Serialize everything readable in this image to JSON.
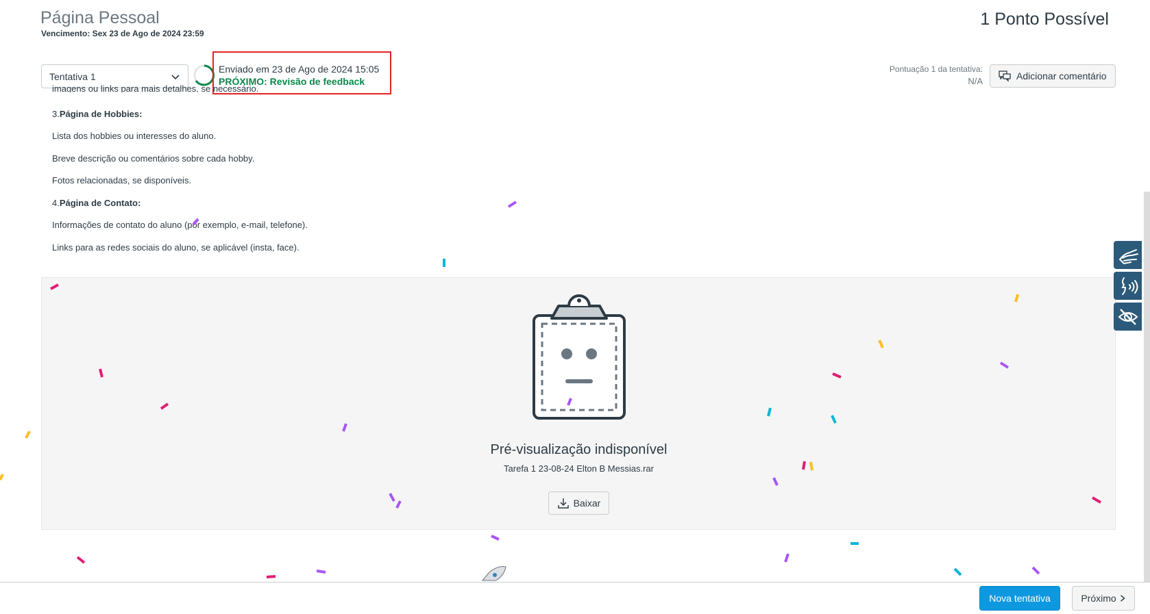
{
  "header": {
    "title": "Página Pessoal",
    "due_date": "Vencimento: Sex 23 de Ago de 2024 23:59",
    "points": "1 Ponto Possível"
  },
  "attempt": {
    "selected": "Tentativa 1",
    "submitted": "Enviado em 23 de Ago de 2024 15:05",
    "next": "PRÓXIMO: Revisão de feedback"
  },
  "score": {
    "label": "Pontuação 1 da tentativa:",
    "value": "N/A"
  },
  "comment_button": "Adicionar comentário",
  "content": {
    "cut_line": "imagens ou links para mais detalhes, se necessário.",
    "lines": [
      {
        "num": "3.",
        "bold": "Página de Hobbies:"
      },
      {
        "text": "Lista dos hobbies ou interesses do aluno."
      },
      {
        "text": "Breve descrição ou comentários sobre cada hobby."
      },
      {
        "text": "Fotos relacionadas, se disponíveis."
      },
      {
        "num": "4.",
        "bold": "Página de Contato:"
      },
      {
        "text": "Informações de contato do aluno (por exemplo, e-mail, telefone)."
      },
      {
        "text": "Links para as redes sociais do aluno, se aplicável (insta, face)."
      }
    ]
  },
  "preview": {
    "title": "Pré-visualização indisponível",
    "file": "Tarefa 1 23-08-24 Elton B Messias.rar",
    "download": "Baixar"
  },
  "footer": {
    "new_attempt": "Nova tentativa",
    "next": "Próximo"
  },
  "icons": {
    "dropdown": "chevron-down-icon",
    "comment": "comment-icon",
    "download": "download-icon",
    "next": "chevron-right-icon",
    "sign_language": "sign-language-icon",
    "voice": "speech-icon",
    "visibility": "eye-slash-icon"
  },
  "colors": {
    "submitted_border": "#e02424",
    "next_text": "#0b874b",
    "primary_button": "#0e98e0",
    "side_tool": "#2c5a7a"
  }
}
